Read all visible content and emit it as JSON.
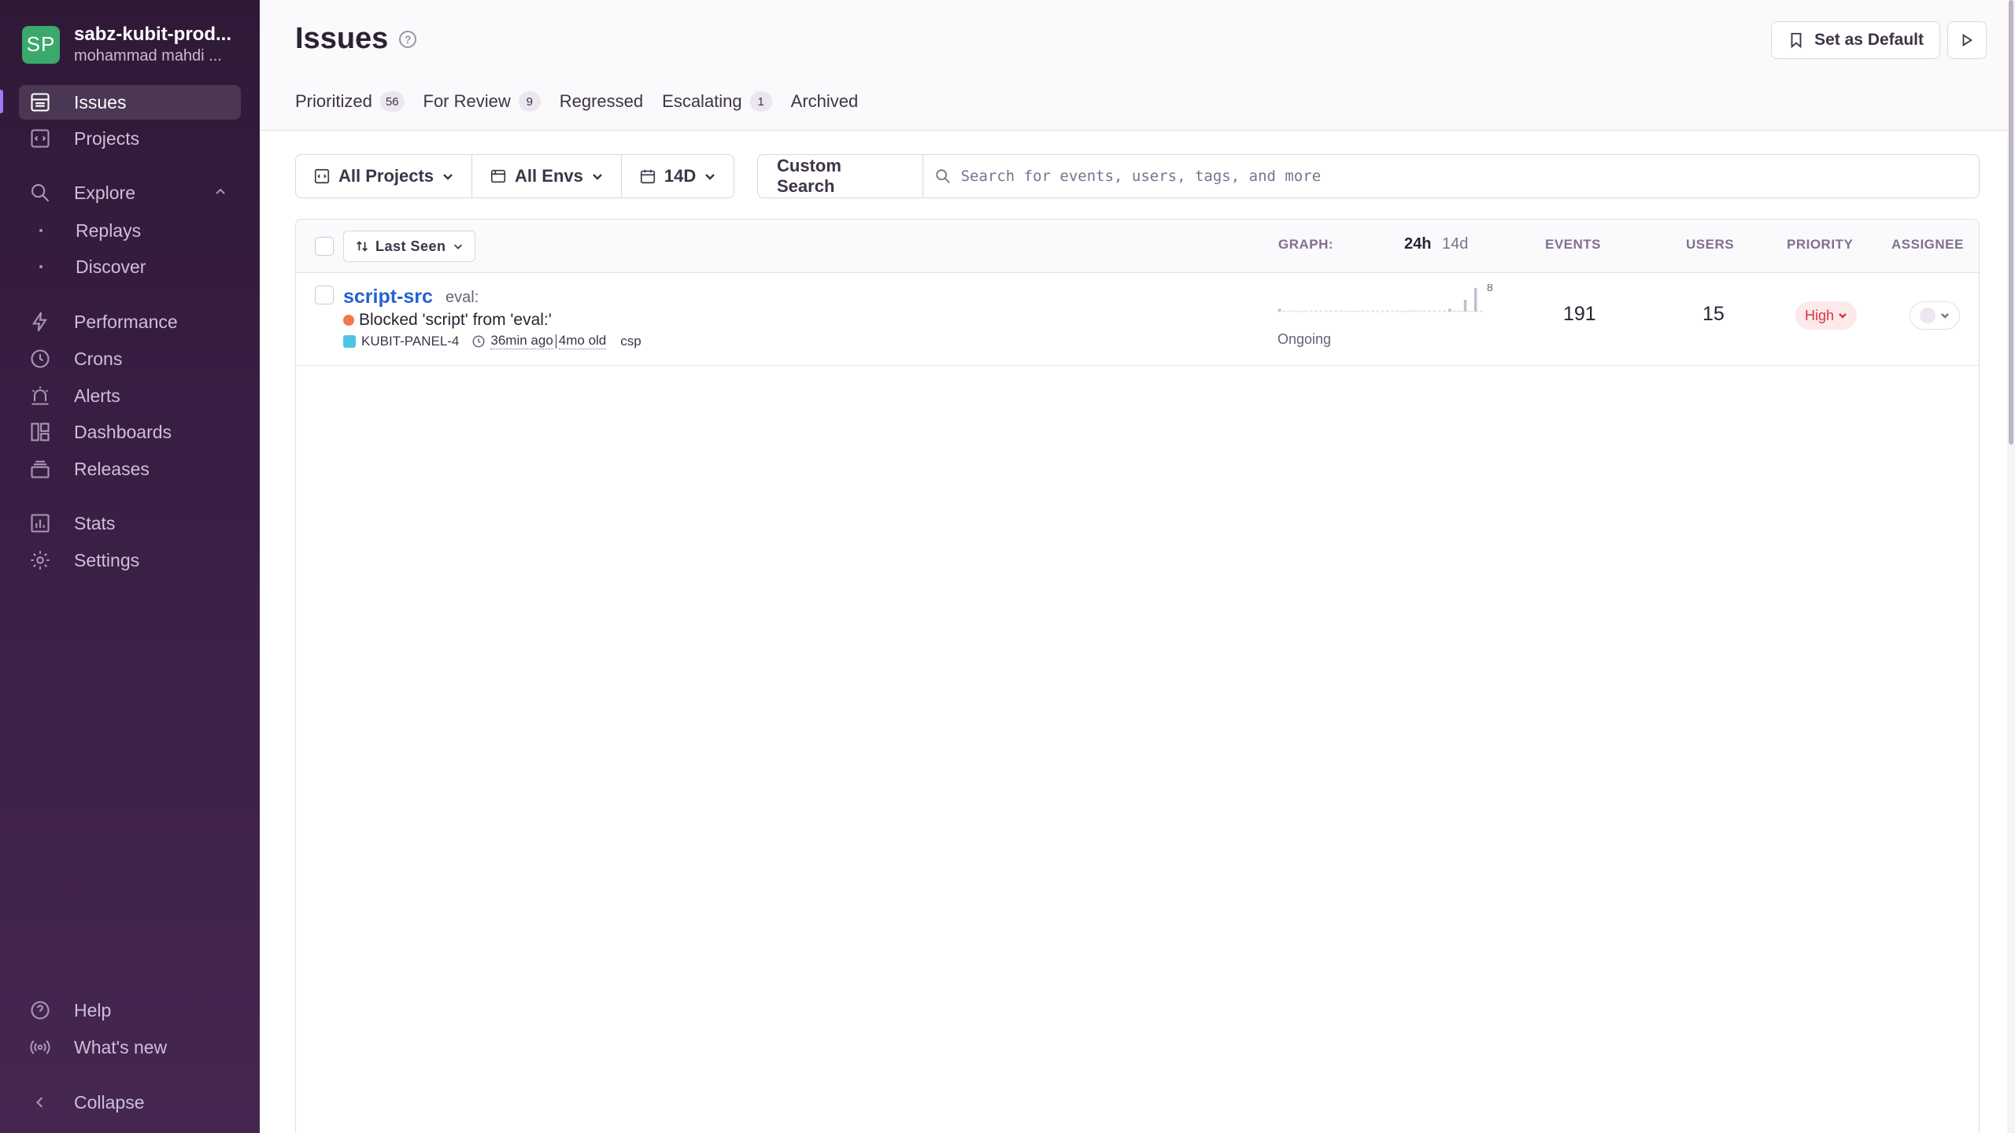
{
  "org": {
    "initials": "SP",
    "name": "sabz-kubit-prod...",
    "user": "mohammad mahdi ..."
  },
  "nav": {
    "issues": "Issues",
    "projects": "Projects",
    "explore": "Explore",
    "replays": "Replays",
    "discover": "Discover",
    "performance": "Performance",
    "crons": "Crons",
    "alerts": "Alerts",
    "dashboards": "Dashboards",
    "releases": "Releases",
    "stats": "Stats",
    "settings": "Settings",
    "help": "Help",
    "whats_new": "What's new",
    "collapse": "Collapse"
  },
  "header": {
    "title": "Issues",
    "set_default": "Set as Default",
    "tabs": [
      {
        "label": "Prioritized",
        "count": "56"
      },
      {
        "label": "For Review",
        "count": "9"
      },
      {
        "label": "Regressed",
        "count": ""
      },
      {
        "label": "Escalating",
        "count": "1"
      },
      {
        "label": "Archived",
        "count": ""
      }
    ]
  },
  "filters": {
    "projects": "All Projects",
    "envs": "All Envs",
    "period": "14D",
    "custom_search": "Custom Search",
    "search_placeholder": "Search for events, users, tags, and more"
  },
  "table": {
    "sort_label": "Last Seen",
    "graph_label": "GRAPH:",
    "graph_24h": "24h",
    "graph_14d": "14d",
    "events_label": "EVENTS",
    "users_label": "USERS",
    "priority_label": "PRIORITY",
    "assignee_label": "ASSIGNEE"
  },
  "issues": [
    {
      "title": "script-src",
      "subtitle": "eval:",
      "message": "Blocked 'script' from 'eval:'",
      "project": "KUBIT-PANEL-4",
      "last_seen": "36min ago",
      "age": "4mo old",
      "tag": "csp",
      "graph_max": "8",
      "graph_values": [
        1,
        0,
        0,
        0,
        0,
        0,
        0,
        0,
        0,
        0,
        0,
        0,
        0,
        0,
        0,
        0,
        0,
        0,
        0,
        0,
        0,
        0,
        0,
        0,
        0,
        0,
        0,
        0,
        0,
        0,
        0,
        0,
        0,
        1,
        0,
        0,
        4,
        0,
        8,
        0
      ],
      "status": "Ongoing",
      "events": "191",
      "users": "15",
      "priority": "High"
    }
  ],
  "colors": {
    "accent": "#2562d4",
    "priority_high": "#d6354a",
    "level_error": "#f2784b",
    "sidebar": "#3a1f45"
  }
}
